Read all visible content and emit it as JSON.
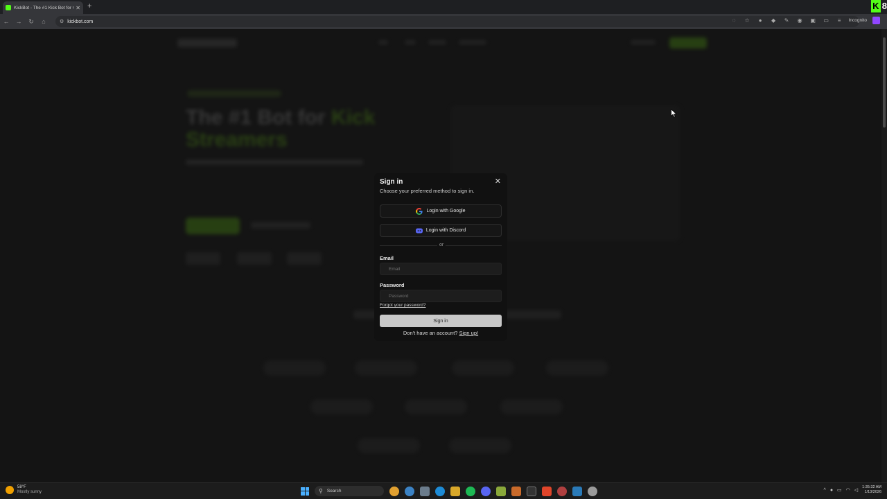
{
  "browser": {
    "tab_title": "KickBot - The #1 Kick Bot for C",
    "tab_close": "✕",
    "new_tab": "+",
    "url": "kickbot.com",
    "incognito_label": "Incognito",
    "overlay_letter": "K",
    "overlay_number": "8",
    "overlay_number_2": "8"
  },
  "page_background": {
    "hero_title_part1": "The #1 Bot for",
    "hero_title_accent": "Kick",
    "hero_title_part2": "Streamers"
  },
  "modal": {
    "title": "Sign in",
    "subtitle": "Choose your preferred method to sign in.",
    "close_icon": "✕",
    "google_label": "Login with Google",
    "discord_label": "Login with Discord",
    "divider_label": "or",
    "email_label": "Email",
    "email_placeholder": "Email",
    "email_value": "",
    "password_label": "Password",
    "password_placeholder": "Password",
    "password_value": "",
    "forgot_label": "Forgot your password?",
    "signin_label": "Sign in",
    "signup_prompt": "Don't have an account?",
    "signup_link": "Sign up!"
  },
  "taskbar": {
    "weather_temp": "58°F",
    "weather_desc": "Mostly sunny",
    "search_label": "Search",
    "time": "1:35:32 AM",
    "date": "1/13/2026"
  },
  "colors": {
    "accent": "#53fc18",
    "discord": "#5865f2",
    "signin_button": "#c8c8c8"
  }
}
